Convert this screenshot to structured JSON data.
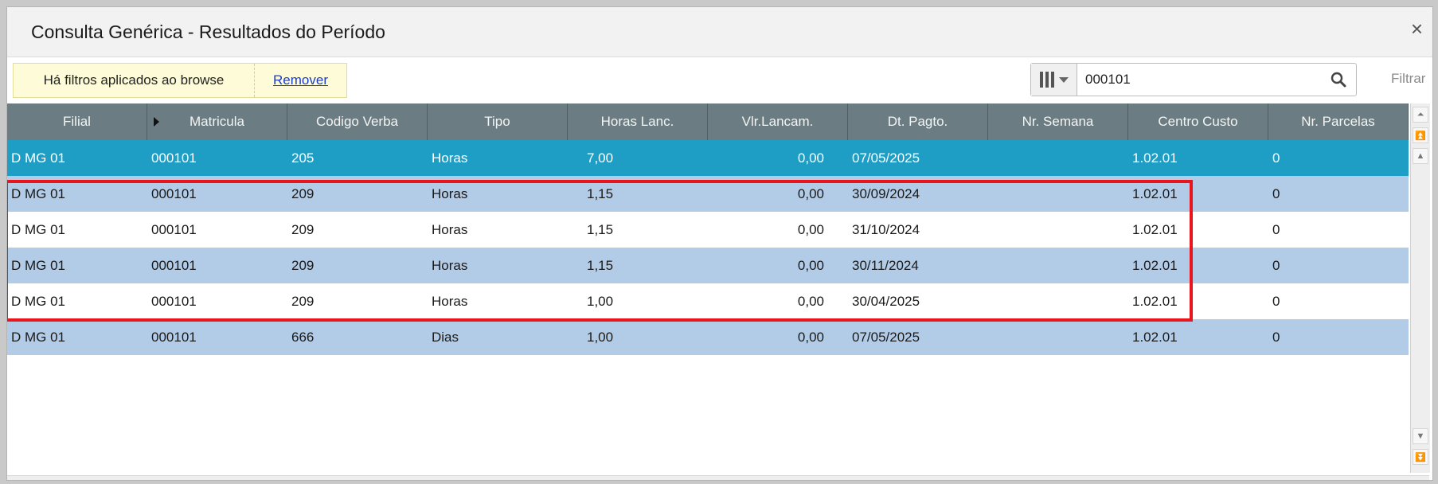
{
  "window": {
    "title": "Consulta Genérica - Resultados do Período",
    "close_label": "×"
  },
  "filter": {
    "message": "Há filtros aplicados ao browse",
    "remove_label": "Remover"
  },
  "search": {
    "value": "000101",
    "placeholder": "",
    "filter_label": "Filtrar"
  },
  "columns": [
    "Filial",
    "Matricula",
    "Codigo Verba",
    "Tipo",
    "Horas Lanc.",
    "Vlr.Lancam.",
    "Dt. Pagto.",
    "Nr. Semana",
    "Centro Custo",
    "Nr. Parcelas"
  ],
  "rows": [
    [
      "D MG 01",
      "000101",
      "205",
      "Horas",
      "7,00",
      "0,00",
      "07/05/2025",
      "",
      "1.02.01",
      "0"
    ],
    [
      "D MG 01",
      "000101",
      "209",
      "Horas",
      "1,15",
      "0,00",
      "30/09/2024",
      "",
      "1.02.01",
      "0"
    ],
    [
      "D MG 01",
      "000101",
      "209",
      "Horas",
      "1,15",
      "0,00",
      "31/10/2024",
      "",
      "1.02.01",
      "0"
    ],
    [
      "D MG 01",
      "000101",
      "209",
      "Horas",
      "1,15",
      "0,00",
      "30/11/2024",
      "",
      "1.02.01",
      "0"
    ],
    [
      "D MG 01",
      "000101",
      "209",
      "Horas",
      "1,00",
      "0,00",
      "30/04/2025",
      "",
      "1.02.01",
      "0"
    ],
    [
      "D MG 01",
      "000101",
      "666",
      "Dias",
      "1,00",
      "0,00",
      "07/05/2025",
      "",
      "1.02.01",
      "0"
    ]
  ],
  "selected_row": 0,
  "highlighted_rows": [
    1,
    2,
    3,
    4
  ],
  "colors": {
    "header": "#6b7d82",
    "selected": "#1e9ec4",
    "alt_row": "#b2cbe6",
    "highlight": "#e8151c"
  },
  "icons": {
    "search": "search-icon",
    "columns": "columns-icon",
    "close": "close-icon"
  }
}
